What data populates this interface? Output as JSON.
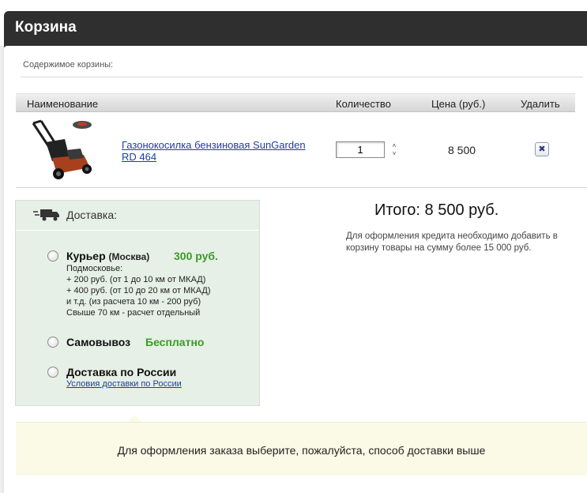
{
  "header": {
    "title": "Корзина"
  },
  "cart": {
    "contents_label": "Содержимое корзины:",
    "columns": {
      "name": "Наименование",
      "quantity": "Количество",
      "price": "Цена (руб.)",
      "delete": "Удалить"
    },
    "items": [
      {
        "name": "Газонокосилка бензиновая SunGarden RD 464",
        "quantity": "1",
        "price": "8 500",
        "delete_glyph": "✖"
      }
    ]
  },
  "delivery": {
    "title": "Доставка:",
    "icon": "truck-icon",
    "options": [
      {
        "title": "Курьер",
        "subtitle": "(Москва)",
        "price": "300 руб.",
        "desc": [
          "Подмосковье:",
          "+ 200 руб. (от 1 до 10 км от МКАД)",
          "+ 400 руб. (от 10 до 20 км от МКАД)",
          "и т.д. (из расчета 10 км - 200 руб)",
          "Свыше 70 км - расчет отдельный"
        ]
      },
      {
        "title": "Самовывоз",
        "price": "Бесплатно"
      },
      {
        "title": "Доставка по России",
        "link": "Условия доставки по России"
      }
    ]
  },
  "summary": {
    "total": "Итого: 8 500 руб.",
    "credit_note": "Для оформления кредита необходимо добавить в корзину товары на сумму более 15 000 руб."
  },
  "notice": {
    "text": "Для оформления заказа выберите, пожалуйста, способ доставки выше"
  },
  "colors": {
    "header_bg": "#2f2f2f",
    "price_green": "#3d9a2a",
    "link_blue": "#1a3f9e",
    "delivery_bg": "#e6f0e6",
    "notice_bg": "#fafae6"
  }
}
